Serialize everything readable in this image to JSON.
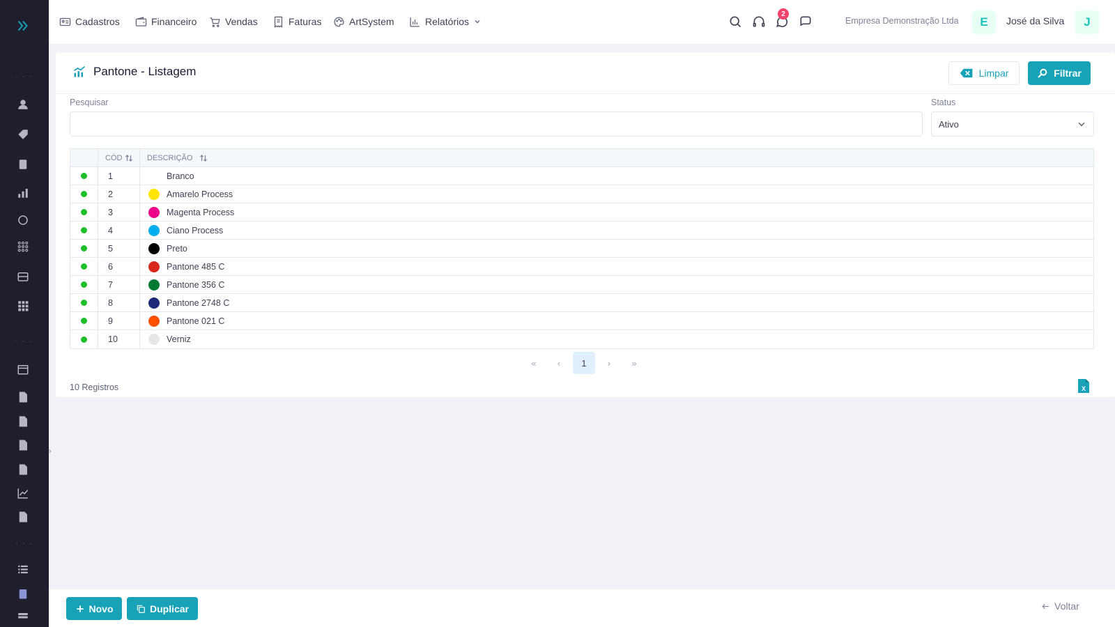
{
  "nav": {
    "items": [
      {
        "label": "Cadastros",
        "icon": "id-card-icon"
      },
      {
        "label": "Financeiro",
        "icon": "wallet-icon"
      },
      {
        "label": "Vendas",
        "icon": "cart-icon"
      },
      {
        "label": "Faturas",
        "icon": "receipt-icon"
      },
      {
        "label": "ArtSystem",
        "icon": "palette-icon"
      },
      {
        "label": "Relatórios",
        "icon": "bar-chart-icon"
      }
    ],
    "notification_count": "2",
    "company": "Empresa Demonstração Ltda",
    "company_initial": "E",
    "user": "José da Silva",
    "user_initial": "J"
  },
  "sidebar": {
    "dots": "· · ·"
  },
  "page": {
    "title": "Pantone - Listagem",
    "clear_label": "Limpar",
    "filter_label": "Filtrar",
    "search_label": "Pesquisar",
    "search_value": "",
    "status_label": "Status",
    "status_value": "Ativo"
  },
  "table": {
    "headers": {
      "code": "CÓD",
      "description": "DESCRIÇÃO"
    },
    "rows": [
      {
        "code": "1",
        "description": "Branco",
        "swatch": "#ffffff"
      },
      {
        "code": "2",
        "description": "Amarelo Process",
        "swatch": "#ffe500"
      },
      {
        "code": "3",
        "description": "Magenta Process",
        "swatch": "#ec008c"
      },
      {
        "code": "4",
        "description": "Ciano Process",
        "swatch": "#00aeef"
      },
      {
        "code": "5",
        "description": "Preto",
        "swatch": "#000000"
      },
      {
        "code": "6",
        "description": "Pantone 485 C",
        "swatch": "#da291c"
      },
      {
        "code": "7",
        "description": "Pantone 356 C",
        "swatch": "#007a33"
      },
      {
        "code": "8",
        "description": "Pantone 2748 C",
        "swatch": "#1e2a78"
      },
      {
        "code": "9",
        "description": "Pantone 021 C",
        "swatch": "#fe5000"
      },
      {
        "code": "10",
        "description": "Verniz",
        "swatch": "#e6e6e6"
      }
    ]
  },
  "pagination": {
    "first": "«",
    "prev": "‹",
    "current": "1",
    "next": "›",
    "last": "»"
  },
  "records_label": "10 Registros",
  "footer": {
    "new_label": "Novo",
    "duplicate_label": "Duplicar",
    "back_label": "Voltar"
  },
  "colors": {
    "accent": "#17a2b8",
    "sidebar": "#1e1e2d",
    "status_active": "#1fbf2b"
  }
}
